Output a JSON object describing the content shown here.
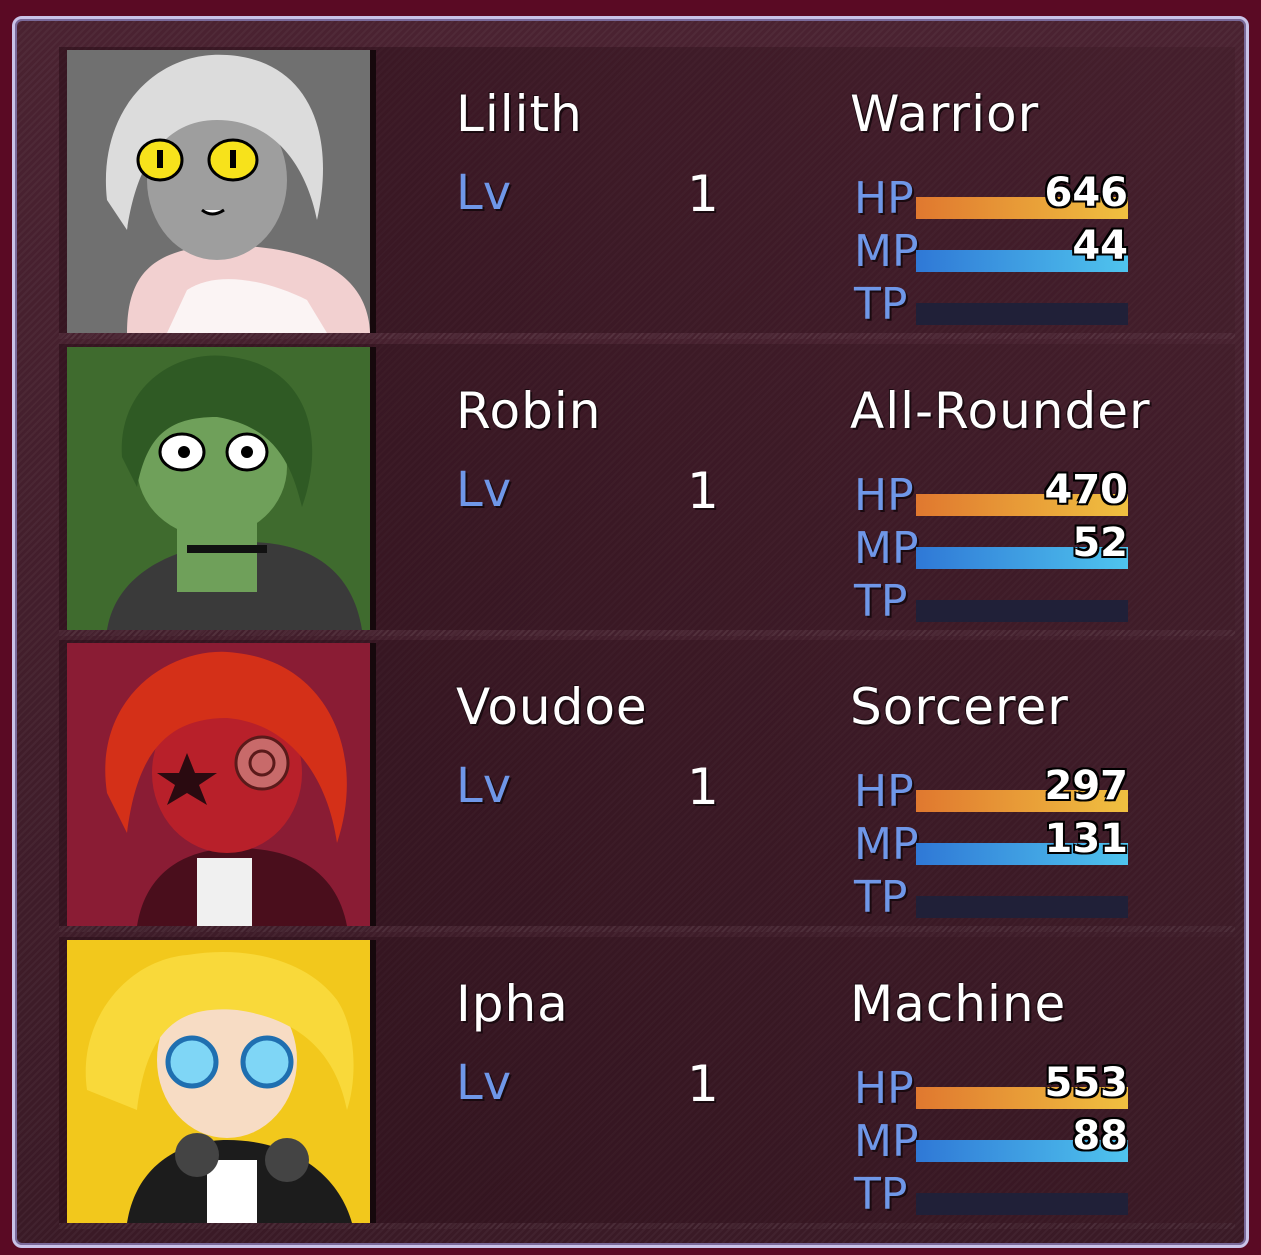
{
  "labels": {
    "lv": "Lv",
    "hp": "HP",
    "mp": "MP",
    "tp": "TP"
  },
  "party": [
    {
      "name": "Lilith",
      "class": "Warrior",
      "level": "1",
      "hp": "646",
      "mp": "44",
      "hp_fill": 1.0,
      "mp_fill": 1.0,
      "tp_fill": 0.0,
      "portrait_bg": "#707070"
    },
    {
      "name": "Robin",
      "class": "All-Rounder",
      "level": "1",
      "hp": "470",
      "mp": "52",
      "hp_fill": 1.0,
      "mp_fill": 1.0,
      "tp_fill": 0.0,
      "portrait_bg": "#3f6b2e"
    },
    {
      "name": "Voudoe",
      "class": "Sorcerer",
      "level": "1",
      "hp": "297",
      "mp": "131",
      "hp_fill": 1.0,
      "mp_fill": 1.0,
      "tp_fill": 0.0,
      "portrait_bg": "#8a1c34"
    },
    {
      "name": "Ipha",
      "class": "Machine",
      "level": "1",
      "hp": "553",
      "mp": "88",
      "hp_fill": 1.0,
      "mp_fill": 1.0,
      "tp_fill": 0.0,
      "portrait_bg": "#f2c81c"
    }
  ]
}
